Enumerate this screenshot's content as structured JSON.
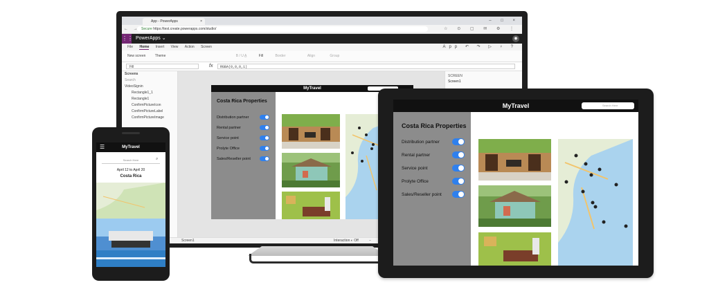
{
  "browser": {
    "tab_title": "App - PowerApps",
    "tab_close": "×",
    "window_controls": "‒ □ ×",
    "nav_icons": "← → ⟳",
    "secure_label": "Secure",
    "url": "https://test.create.powerapps.com/studio/",
    "extension_icons": "☆ ⊙ ▢ ✉ ⚙ ⋮"
  },
  "studio": {
    "brand": "PowerApps",
    "brand_chevron": "⌄",
    "user_icon": "◉",
    "menu": [
      "File",
      "Home",
      "Insert",
      "View",
      "Action",
      "Screen"
    ],
    "menu_right_label": "App",
    "menu_right_icons": "↶ ↷ ▷ ♀ ?",
    "ribbon": {
      "new_screen": "New screen",
      "theme": "Theme",
      "fill": "Fill",
      "border": "Border",
      "align": "Align",
      "group": "Group"
    },
    "property": "Fill",
    "fx": "fx",
    "formula": "RGBA(0,0,0,1)",
    "tree_header": "Screens",
    "tree_search": "Search",
    "tree_items": [
      "VideoSignin",
      "Rectangle1_1",
      "Rectangle1",
      "ConfirmPictureIcon",
      "ConfirmPictureLabel",
      "ConfirmPictureImage"
    ],
    "prop_panel_label": "SCREEN",
    "prop_panel_value": "Screen1",
    "status_screen": "Screen1",
    "status_interaction": "Interaction",
    "status_off": "Off",
    "status_zoom_minus": "−"
  },
  "app": {
    "title": "MyTravel",
    "heading": "Costa Rica Properties",
    "filters": [
      "Distribution partner",
      "Rental partner",
      "Service point",
      "Prolyte Office",
      "Sales/Reseller point"
    ],
    "search_placeholder": "Search Here",
    "accent": "#2f80ed",
    "sidebar_color": "#8c8c8c"
  },
  "phone": {
    "title": "MyTravel",
    "menu_icon": "☰",
    "search_placeholder": "Search Here",
    "search_icon": "⌕",
    "dates": "April 12 to April 20",
    "city": "Costa Rica"
  }
}
